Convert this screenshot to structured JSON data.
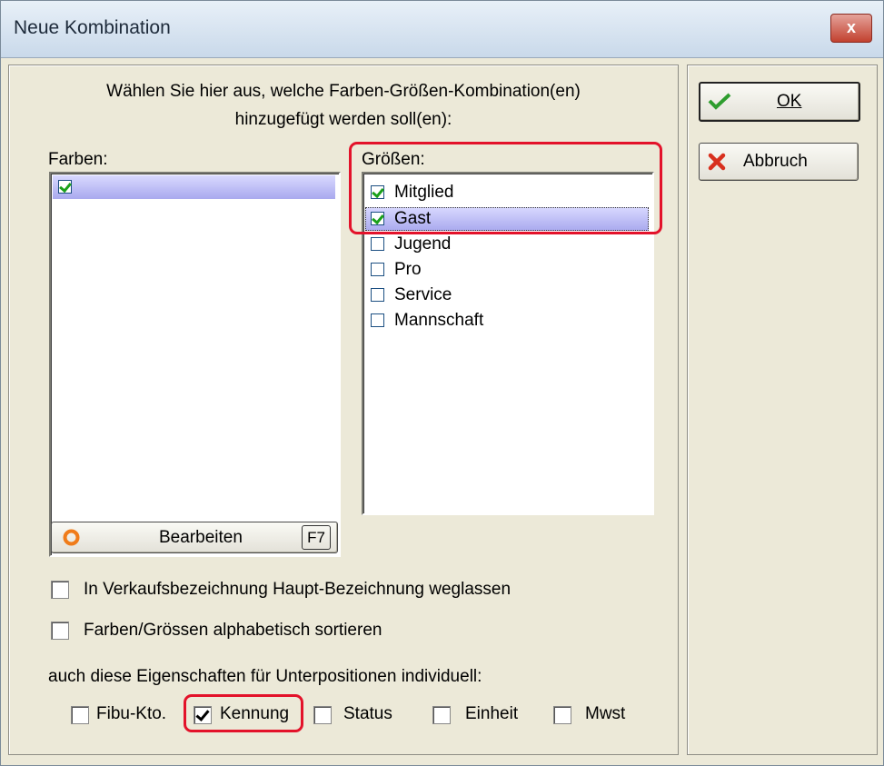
{
  "window": {
    "title": "Neue Kombination",
    "close_glyph": "x"
  },
  "instruction": {
    "line1": "Wählen Sie hier aus, welche Farben-Größen-Kombination(en)",
    "line2": "hinzugefügt werden soll(en):"
  },
  "farben": {
    "label": "Farben:",
    "items": [
      {
        "label": "",
        "checked": true,
        "selected": true
      }
    ]
  },
  "groessen": {
    "label": "Größen:",
    "items": [
      {
        "label": "Mitglied",
        "checked": true
      },
      {
        "label": "Gast",
        "checked": true,
        "selected": true
      },
      {
        "label": "Jugend",
        "checked": false
      },
      {
        "label": "Pro",
        "checked": false
      },
      {
        "label": "Service",
        "checked": false
      },
      {
        "label": "Mannschaft",
        "checked": false
      }
    ]
  },
  "edit_button": {
    "label": "Bearbeiten",
    "shortcut": "F7",
    "icon": "orange-ring-icon"
  },
  "options": {
    "omit_main_name": {
      "label": "In Verkaufsbezeichnung Haupt-Bezeichnung weglassen",
      "checked": false
    },
    "sort_alpha": {
      "label": "Farben/Grössen alphabetisch sortieren",
      "checked": false
    }
  },
  "subpositions": {
    "label": "auch diese Eigenschaften für Unterpositionen individuell:",
    "items": [
      {
        "label": "Fibu-Kto.",
        "checked": false
      },
      {
        "label": "Kennung",
        "checked": true
      },
      {
        "label": "Status",
        "checked": false
      },
      {
        "label": "Einheit",
        "checked": false
      },
      {
        "label": "Mwst",
        "checked": false
      }
    ]
  },
  "buttons": {
    "ok": "OK",
    "cancel": "Abbruch",
    "ok_icon": "green-check-icon",
    "cancel_icon": "red-x-icon"
  },
  "colors": {
    "highlight": "#e3122a",
    "selection": "#b5b5f0",
    "checkmark": "#1aa01a"
  }
}
